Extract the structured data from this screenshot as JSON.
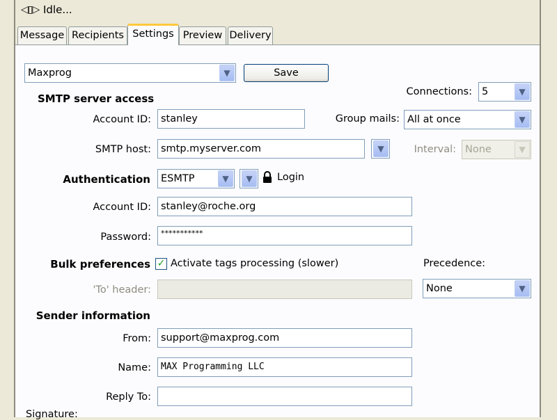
{
  "status": {
    "icon": "plug-icon",
    "text": "Idle..."
  },
  "tabs": [
    {
      "label": "Message"
    },
    {
      "label": "Recipients"
    },
    {
      "label": "Settings"
    },
    {
      "label": "Preview"
    },
    {
      "label": "Delivery"
    }
  ],
  "active_tab": "Settings",
  "profile": {
    "selected": "Maxprog",
    "save_label": "Save"
  },
  "smtp": {
    "heading": "SMTP server access",
    "account_label": "Account ID:",
    "account_value": "stanley",
    "host_label": "SMTP host:",
    "host_value": "smtp.myserver.com"
  },
  "connections": {
    "label": "Connections:",
    "value": "5"
  },
  "group_mails": {
    "label": "Group mails:",
    "value": "All at once"
  },
  "interval": {
    "label": "Interval:",
    "value": "None"
  },
  "auth": {
    "heading": "Authentication",
    "method": "ESMTP",
    "login_label": "Login",
    "account_label": "Account ID:",
    "account_value": "stanley@roche.org",
    "password_label": "Password:",
    "password_value": "***********"
  },
  "bulk": {
    "heading": "Bulk preferences",
    "activate_tags_label": "Activate tags processing (slower)",
    "activate_tags_checked": true,
    "to_header_label": "'To' header:",
    "to_header_value": ""
  },
  "precedence": {
    "label": "Precedence:",
    "value": "None"
  },
  "sender": {
    "heading": "Sender information",
    "from_label": "From:",
    "from_value": "support@maxprog.com",
    "name_label": "Name:",
    "name_value": "MAX Programming LLC",
    "reply_to_label": "Reply To:",
    "reply_to_value": ""
  },
  "signature": {
    "label": "Signature:"
  },
  "colors": {
    "window_bg": "#ece9d8",
    "panel_bg": "#fcfcfe",
    "field_border": "#7f9db9",
    "tab_highlight": "#ffc83c"
  }
}
